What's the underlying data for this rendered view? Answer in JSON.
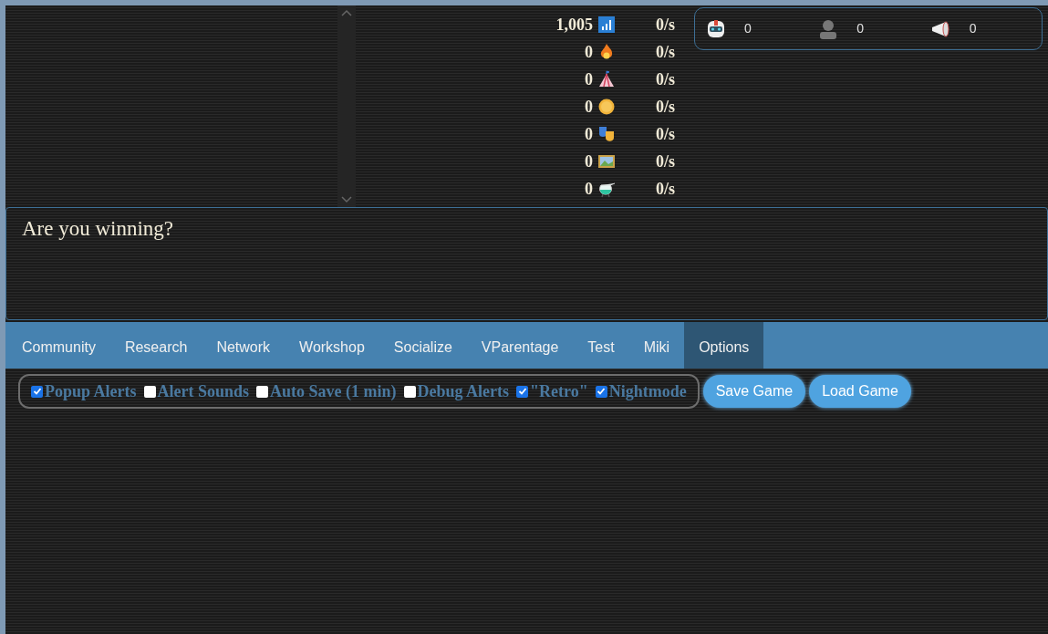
{
  "resources": [
    {
      "kind": "signal",
      "amount": "1,005",
      "rate": "0/s"
    },
    {
      "kind": "fire",
      "amount": "0",
      "rate": "0/s"
    },
    {
      "kind": "tent",
      "amount": "0",
      "rate": "0/s"
    },
    {
      "kind": "coin",
      "amount": "0",
      "rate": "0/s"
    },
    {
      "kind": "masks",
      "amount": "0",
      "rate": "0/s"
    },
    {
      "kind": "picture",
      "amount": "0",
      "rate": "0/s"
    },
    {
      "kind": "flask",
      "amount": "0",
      "rate": "0/s"
    }
  ],
  "counters": [
    {
      "kind": "robot",
      "value": "0"
    },
    {
      "kind": "person",
      "value": "0"
    },
    {
      "kind": "megaphone",
      "value": "0"
    }
  ],
  "message": "Are you winning?",
  "tabs": [
    {
      "label": "Community",
      "selected": false
    },
    {
      "label": "Research",
      "selected": false
    },
    {
      "label": "Network",
      "selected": false
    },
    {
      "label": "Workshop",
      "selected": false
    },
    {
      "label": "Socialize",
      "selected": false
    },
    {
      "label": "VParentage",
      "selected": false
    },
    {
      "label": "Test",
      "selected": false
    },
    {
      "label": "Miki",
      "selected": false
    },
    {
      "label": "Options",
      "selected": true
    }
  ],
  "options": [
    {
      "label": "Popup Alerts",
      "checked": true
    },
    {
      "label": "Alert Sounds",
      "checked": false
    },
    {
      "label": "Auto Save (1 min)",
      "checked": false
    },
    {
      "label": "Debug Alerts",
      "checked": false
    },
    {
      "label": "\"Retro\"",
      "checked": true
    },
    {
      "label": "Nightmode",
      "checked": true
    }
  ],
  "buttons": [
    "Save Game",
    "Load Game"
  ]
}
